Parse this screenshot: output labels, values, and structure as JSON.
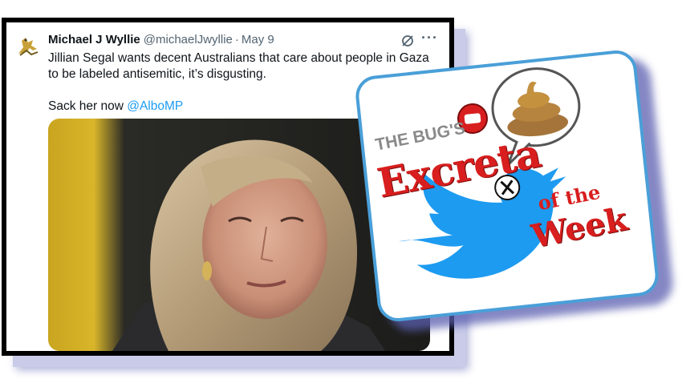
{
  "tweet": {
    "author": "Michael J Wyllie",
    "handle": "@michaelJwyllie",
    "separator": "·",
    "date": "May 9",
    "more_icon": "more-horizontal-icon",
    "grok_icon": "grok-icon",
    "text_line1": "Jillian Segal wants decent Australians that care about people in Gaza to be labeled antisemitic, it’s disgusting.",
    "text_line2_prefix": "Sack her now ",
    "mention": "@AlboMP",
    "photo_alt": "photo-of-woman"
  },
  "badge": {
    "bugs": "THE BUG'S",
    "excreta": "Excreta",
    "of_the": "of the",
    "week": "Week",
    "x_logo": "x-logo-icon",
    "bird": "bird-icon",
    "poop": "poop-icon",
    "fist": "raised-fist-icon"
  },
  "colors": {
    "accent_blue": "#1d9bf0",
    "badge_border": "#4a9fd8",
    "red": "#d81e1e",
    "shadow": "#5b5fb0"
  }
}
